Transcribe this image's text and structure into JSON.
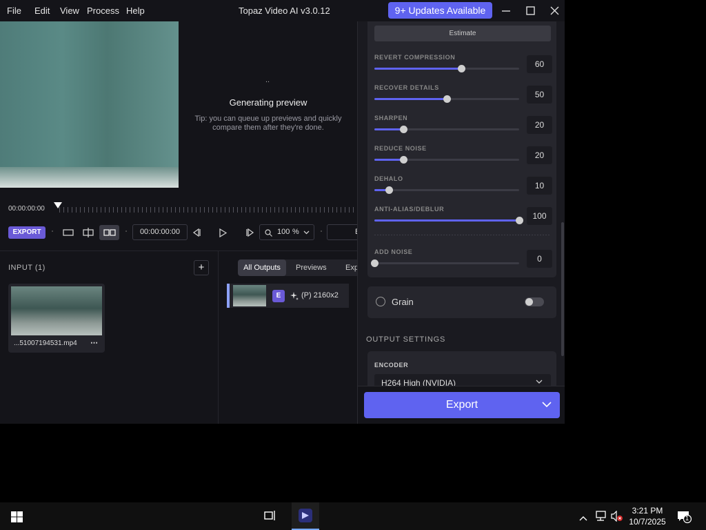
{
  "app": {
    "menu": [
      "File",
      "Edit",
      "View",
      "Process",
      "Help"
    ],
    "title": "Topaz Video AI  v3.0.12",
    "updates_label": "9+ Updates Available"
  },
  "preview": {
    "dots": "..",
    "status": "Generating preview",
    "tip": "Tip: you can queue up previews and quickly compare them after they're done."
  },
  "timeline": {
    "start_time": "00:00:00:00",
    "export_tag": "EXPORT",
    "timecode": "00:00:00:00",
    "zoom_value": "100",
    "zoom_unit": "%",
    "back_label": "Back"
  },
  "input": {
    "title": "INPUT (1)",
    "add_label": "+",
    "file_name": "...51007194531.mp4",
    "more": "⋯"
  },
  "outputs": {
    "tabs": [
      "All Outputs",
      "Previews",
      "Export"
    ],
    "row_badge": "E",
    "row_text": "(P)  2160x2"
  },
  "enhancement": {
    "estimate_label": "Estimate",
    "sliders": [
      {
        "label": "REVERT COMPRESSION",
        "value": 60,
        "fraction": 0.6
      },
      {
        "label": "RECOVER DETAILS",
        "value": 50,
        "fraction": 0.5
      },
      {
        "label": "SHARPEN",
        "value": 20,
        "fraction": 0.2
      },
      {
        "label": "REDUCE NOISE",
        "value": 20,
        "fraction": 0.2
      },
      {
        "label": "DEHALO",
        "value": 10,
        "fraction": 0.1
      },
      {
        "label": "ANTI-ALIAS/DEBLUR",
        "value": 100,
        "fraction": 1.0
      },
      {
        "label": "ADD NOISE",
        "value": 0,
        "fraction": 0.0
      }
    ]
  },
  "grain": {
    "label": "Grain",
    "enabled": false
  },
  "output_settings": {
    "title": "OUTPUT SETTINGS",
    "encoder_label": "ENCODER",
    "encoder_value": "H264 High (NVIDIA)"
  },
  "export_button": {
    "label": "Export"
  },
  "taskbar": {
    "time": "3:21 PM",
    "date": "10/7/2025",
    "notification_count": "1"
  },
  "colors": {
    "accent": "#5f63f0",
    "export_tag": "#6a5ad7",
    "background": "#141419",
    "panel": "#26262d"
  }
}
